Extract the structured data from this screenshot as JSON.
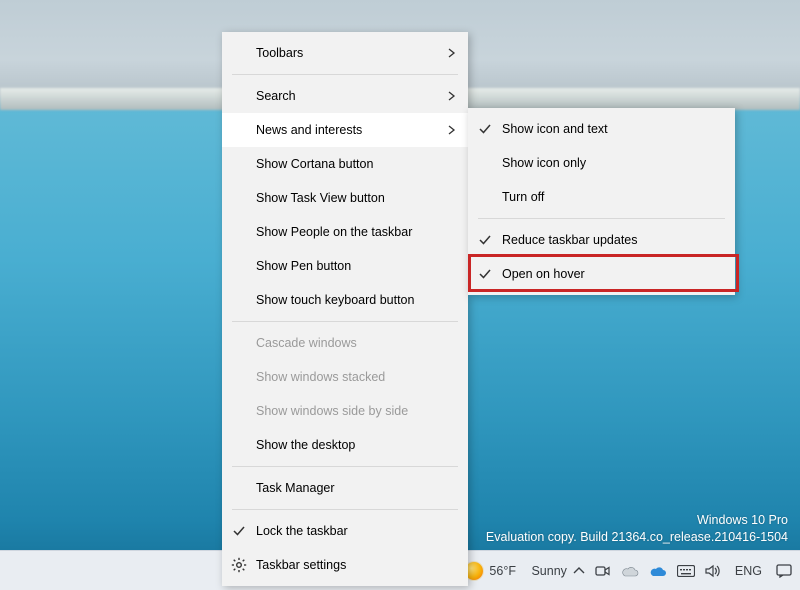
{
  "watermark": {
    "line1": "Windows 10 Pro",
    "line2": "Evaluation copy. Build 21364.co_release.210416-1504"
  },
  "taskbar": {
    "weather_temp": "56°F",
    "weather_cond": "Sunny",
    "lang": "ENG"
  },
  "main_menu": [
    {
      "key": "toolbars",
      "label": "Toolbars",
      "submenu": true
    },
    {
      "sep": true
    },
    {
      "key": "search",
      "label": "Search",
      "submenu": true
    },
    {
      "key": "news",
      "label": "News and interests",
      "submenu": true,
      "hovered": true
    },
    {
      "key": "cortana",
      "label": "Show Cortana button"
    },
    {
      "key": "taskview",
      "label": "Show Task View button"
    },
    {
      "key": "people",
      "label": "Show People on the taskbar"
    },
    {
      "key": "pen",
      "label": "Show Pen button"
    },
    {
      "key": "touchkb",
      "label": "Show touch keyboard button"
    },
    {
      "sep": true
    },
    {
      "key": "cascade",
      "label": "Cascade windows",
      "disabled": true
    },
    {
      "key": "stacked",
      "label": "Show windows stacked",
      "disabled": true
    },
    {
      "key": "sidebyside",
      "label": "Show windows side by side",
      "disabled": true
    },
    {
      "key": "showdesktop",
      "label": "Show the desktop"
    },
    {
      "sep": true
    },
    {
      "key": "taskmgr",
      "label": "Task Manager"
    },
    {
      "sep": true
    },
    {
      "key": "lock",
      "label": "Lock the taskbar",
      "checked": true
    },
    {
      "key": "settings",
      "label": "Taskbar settings",
      "icon": "gear"
    }
  ],
  "sub_menu": [
    {
      "key": "icontext",
      "label": "Show icon and text",
      "checked": true
    },
    {
      "key": "icononly",
      "label": "Show icon only"
    },
    {
      "key": "turnoff",
      "label": "Turn off"
    },
    {
      "sep": true
    },
    {
      "key": "reduceupd",
      "label": "Reduce taskbar updates",
      "checked": true
    },
    {
      "key": "openhover",
      "label": "Open on hover",
      "checked": true,
      "highlight": true
    }
  ]
}
